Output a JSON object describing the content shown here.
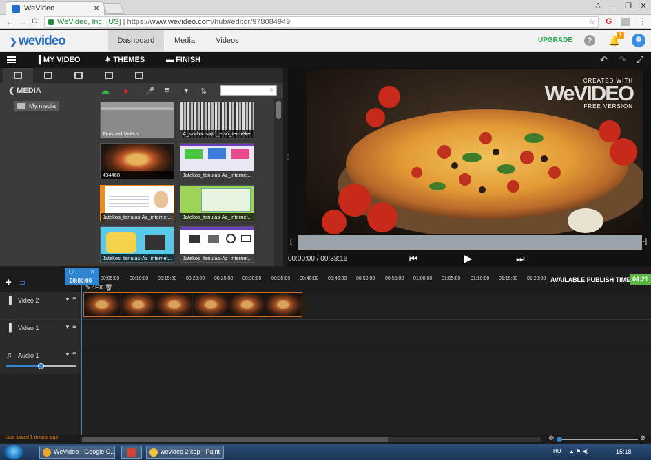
{
  "browser": {
    "tab_title": "WeVideo",
    "tab_close": "✕",
    "win_user": "♙",
    "win_min": "─",
    "win_max": "❐",
    "win_close": "✕",
    "nav_back": "←",
    "nav_forward": "→",
    "nav_reload": "C",
    "address_secure_label": "WeVideo, Inc. [US]",
    "address_separator": " | ",
    "address_url_prefix": "https://",
    "address_url_host": "www.wevideo.com",
    "address_url_path": "/hub#editor/978084949",
    "star": "☆",
    "ext_g": "G",
    "ext_menu": "⋮"
  },
  "app": {
    "logo_text": "wevideo",
    "logo_chev": "❯",
    "nav": [
      {
        "label": "Dashboard",
        "active": true
      },
      {
        "label": "Media",
        "active": false
      },
      {
        "label": "Videos",
        "active": false
      }
    ],
    "upgrade": "UPGRADE",
    "help": "?",
    "bell": "🔔",
    "notifications": "1"
  },
  "toolbar": {
    "my_video": "MY VIDEO",
    "themes": "THEMES",
    "finish": "FINISH",
    "icon_film": "▐",
    "icon_wand": "✶",
    "icon_finish": "▬",
    "undo": "↶",
    "redo": "↷",
    "fullscreen": "⤢"
  },
  "media": {
    "back": "❮",
    "title": "MEDIA",
    "folder": "My media",
    "ico_upload": "☁",
    "ico_record": "●",
    "ico_mic": "🎤",
    "ico_list": "≡",
    "ico_filter": "▼",
    "ico_sort": "⇅",
    "search_placeholder": "",
    "search_icon": "⌕",
    "thumbs": [
      {
        "label": "Finished Videos"
      },
      {
        "label": "A_szabadsajtó_első_terméke..."
      },
      {
        "label": "434468"
      },
      {
        "label": "Jatekos_tanulas-Az_internet..."
      },
      {
        "label": "Jatekos_tanulas-Az_internet..."
      },
      {
        "label": "Jatekos_tanulas-Az_internet..."
      },
      {
        "label": "Jatekos_tanulas-Az_internet..."
      },
      {
        "label": "Jatekos_tanulas-Az_internet..."
      }
    ]
  },
  "preview": {
    "watermark_created": "CREATED WITH",
    "watermark_brand": "WeVIDEO",
    "watermark_free": "FREE VERSION",
    "splitter_dots": "⋮",
    "scrub_left": "[·",
    "scrub_right": "·]",
    "current_time": "00:00:00",
    "time_sep": " / ",
    "total_time": "00:38:16",
    "btn_prev": "⏮",
    "btn_play": "▶",
    "btn_next": "⏭"
  },
  "timeline": {
    "plus": "+",
    "magnet": "⊃",
    "playhead_time": "00:00:00",
    "playhead_close": "✕",
    "playhead_shield": "⛉",
    "ticks": [
      "00:05:00",
      "00:10:00",
      "00:15:00",
      "00:20:00",
      "00:25:00",
      "00:30:00",
      "00:35:00",
      "00:40:00",
      "00:45:00",
      "00:50:00",
      "00:55:00",
      "01:00:00",
      "01:05:00",
      "01:10:00",
      "01:15:00",
      "01:20:00"
    ],
    "publish_label": "AVAILABLE PUBLISH TIME",
    "publish_time": "04:21",
    "clip_tools": "✎ ⁄ FX 🗑",
    "tracks": [
      {
        "name": "Video 2",
        "icon": "▐"
      },
      {
        "name": "Video 1",
        "icon": "▐"
      },
      {
        "name": "Audio 1",
        "icon": "♫"
      }
    ],
    "track_dropdown": "▼",
    "track_menu": "≡",
    "audio_volume": 0.5,
    "last_saved": "Last saved 1 minute ago.",
    "zoom_out": "⊖",
    "zoom_in": "⊕"
  },
  "taskbar": {
    "tasks": [
      {
        "label": "WeVideo - Google C...",
        "color": "#e9a92b"
      },
      {
        "label": "",
        "color": "#d9422e"
      },
      {
        "label": "wevideo 2 kep - Paint",
        "color": "#f4c042"
      }
    ],
    "lang": "HU",
    "tray_icons": "▲ ⚑ ◀)",
    "clock": "15:18"
  }
}
